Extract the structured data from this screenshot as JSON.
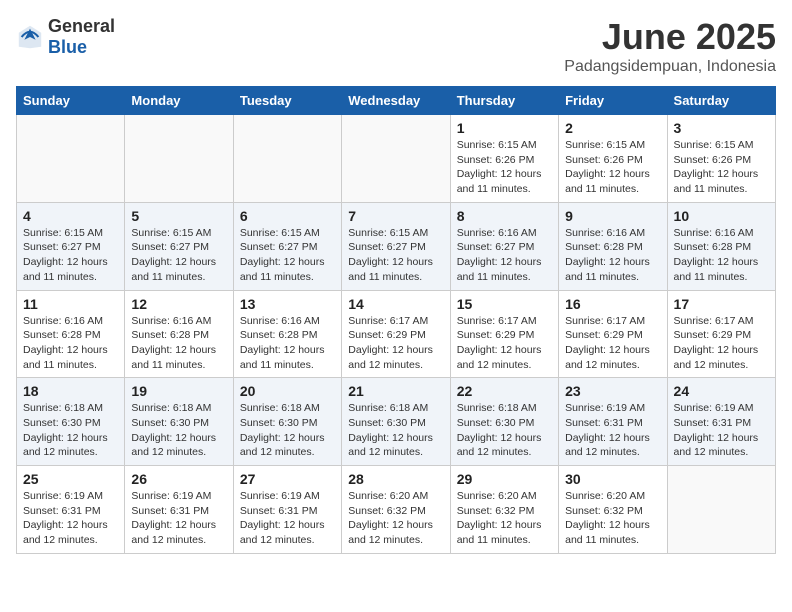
{
  "logo": {
    "text_general": "General",
    "text_blue": "Blue"
  },
  "calendar": {
    "title": "June 2025",
    "subtitle": "Padangsidempuan, Indonesia",
    "days_of_week": [
      "Sunday",
      "Monday",
      "Tuesday",
      "Wednesday",
      "Thursday",
      "Friday",
      "Saturday"
    ],
    "weeks": [
      [
        null,
        null,
        null,
        null,
        {
          "day": "1",
          "sunrise": "Sunrise: 6:15 AM",
          "sunset": "Sunset: 6:26 PM",
          "daylight": "Daylight: 12 hours and 11 minutes."
        },
        {
          "day": "2",
          "sunrise": "Sunrise: 6:15 AM",
          "sunset": "Sunset: 6:26 PM",
          "daylight": "Daylight: 12 hours and 11 minutes."
        },
        {
          "day": "3",
          "sunrise": "Sunrise: 6:15 AM",
          "sunset": "Sunset: 6:26 PM",
          "daylight": "Daylight: 12 hours and 11 minutes."
        }
      ],
      [
        {
          "day": "4",
          "sunrise": "Sunrise: 6:15 AM",
          "sunset": "Sunset: 6:27 PM",
          "daylight": "Daylight: 12 hours and 11 minutes."
        },
        {
          "day": "5",
          "sunrise": "Sunrise: 6:15 AM",
          "sunset": "Sunset: 6:27 PM",
          "daylight": "Daylight: 12 hours and 11 minutes."
        },
        {
          "day": "6",
          "sunrise": "Sunrise: 6:15 AM",
          "sunset": "Sunset: 6:27 PM",
          "daylight": "Daylight: 12 hours and 11 minutes."
        },
        {
          "day": "7",
          "sunrise": "Sunrise: 6:15 AM",
          "sunset": "Sunset: 6:27 PM",
          "daylight": "Daylight: 12 hours and 11 minutes."
        },
        {
          "day": "8",
          "sunrise": "Sunrise: 6:16 AM",
          "sunset": "Sunset: 6:27 PM",
          "daylight": "Daylight: 12 hours and 11 minutes."
        },
        {
          "day": "9",
          "sunrise": "Sunrise: 6:16 AM",
          "sunset": "Sunset: 6:28 PM",
          "daylight": "Daylight: 12 hours and 11 minutes."
        },
        {
          "day": "10",
          "sunrise": "Sunrise: 6:16 AM",
          "sunset": "Sunset: 6:28 PM",
          "daylight": "Daylight: 12 hours and 11 minutes."
        }
      ],
      [
        {
          "day": "11",
          "sunrise": "Sunrise: 6:16 AM",
          "sunset": "Sunset: 6:28 PM",
          "daylight": "Daylight: 12 hours and 11 minutes."
        },
        {
          "day": "12",
          "sunrise": "Sunrise: 6:16 AM",
          "sunset": "Sunset: 6:28 PM",
          "daylight": "Daylight: 12 hours and 11 minutes."
        },
        {
          "day": "13",
          "sunrise": "Sunrise: 6:16 AM",
          "sunset": "Sunset: 6:28 PM",
          "daylight": "Daylight: 12 hours and 11 minutes."
        },
        {
          "day": "14",
          "sunrise": "Sunrise: 6:17 AM",
          "sunset": "Sunset: 6:29 PM",
          "daylight": "Daylight: 12 hours and 12 minutes."
        },
        {
          "day": "15",
          "sunrise": "Sunrise: 6:17 AM",
          "sunset": "Sunset: 6:29 PM",
          "daylight": "Daylight: 12 hours and 12 minutes."
        },
        {
          "day": "16",
          "sunrise": "Sunrise: 6:17 AM",
          "sunset": "Sunset: 6:29 PM",
          "daylight": "Daylight: 12 hours and 12 minutes."
        },
        {
          "day": "17",
          "sunrise": "Sunrise: 6:17 AM",
          "sunset": "Sunset: 6:29 PM",
          "daylight": "Daylight: 12 hours and 12 minutes."
        }
      ],
      [
        {
          "day": "18",
          "sunrise": "Sunrise: 6:18 AM",
          "sunset": "Sunset: 6:30 PM",
          "daylight": "Daylight: 12 hours and 12 minutes."
        },
        {
          "day": "19",
          "sunrise": "Sunrise: 6:18 AM",
          "sunset": "Sunset: 6:30 PM",
          "daylight": "Daylight: 12 hours and 12 minutes."
        },
        {
          "day": "20",
          "sunrise": "Sunrise: 6:18 AM",
          "sunset": "Sunset: 6:30 PM",
          "daylight": "Daylight: 12 hours and 12 minutes."
        },
        {
          "day": "21",
          "sunrise": "Sunrise: 6:18 AM",
          "sunset": "Sunset: 6:30 PM",
          "daylight": "Daylight: 12 hours and 12 minutes."
        },
        {
          "day": "22",
          "sunrise": "Sunrise: 6:18 AM",
          "sunset": "Sunset: 6:30 PM",
          "daylight": "Daylight: 12 hours and 12 minutes."
        },
        {
          "day": "23",
          "sunrise": "Sunrise: 6:19 AM",
          "sunset": "Sunset: 6:31 PM",
          "daylight": "Daylight: 12 hours and 12 minutes."
        },
        {
          "day": "24",
          "sunrise": "Sunrise: 6:19 AM",
          "sunset": "Sunset: 6:31 PM",
          "daylight": "Daylight: 12 hours and 12 minutes."
        }
      ],
      [
        {
          "day": "25",
          "sunrise": "Sunrise: 6:19 AM",
          "sunset": "Sunset: 6:31 PM",
          "daylight": "Daylight: 12 hours and 12 minutes."
        },
        {
          "day": "26",
          "sunrise": "Sunrise: 6:19 AM",
          "sunset": "Sunset: 6:31 PM",
          "daylight": "Daylight: 12 hours and 12 minutes."
        },
        {
          "day": "27",
          "sunrise": "Sunrise: 6:19 AM",
          "sunset": "Sunset: 6:31 PM",
          "daylight": "Daylight: 12 hours and 12 minutes."
        },
        {
          "day": "28",
          "sunrise": "Sunrise: 6:20 AM",
          "sunset": "Sunset: 6:32 PM",
          "daylight": "Daylight: 12 hours and 12 minutes."
        },
        {
          "day": "29",
          "sunrise": "Sunrise: 6:20 AM",
          "sunset": "Sunset: 6:32 PM",
          "daylight": "Daylight: 12 hours and 11 minutes."
        },
        {
          "day": "30",
          "sunrise": "Sunrise: 6:20 AM",
          "sunset": "Sunset: 6:32 PM",
          "daylight": "Daylight: 12 hours and 11 minutes."
        },
        null
      ]
    ]
  }
}
